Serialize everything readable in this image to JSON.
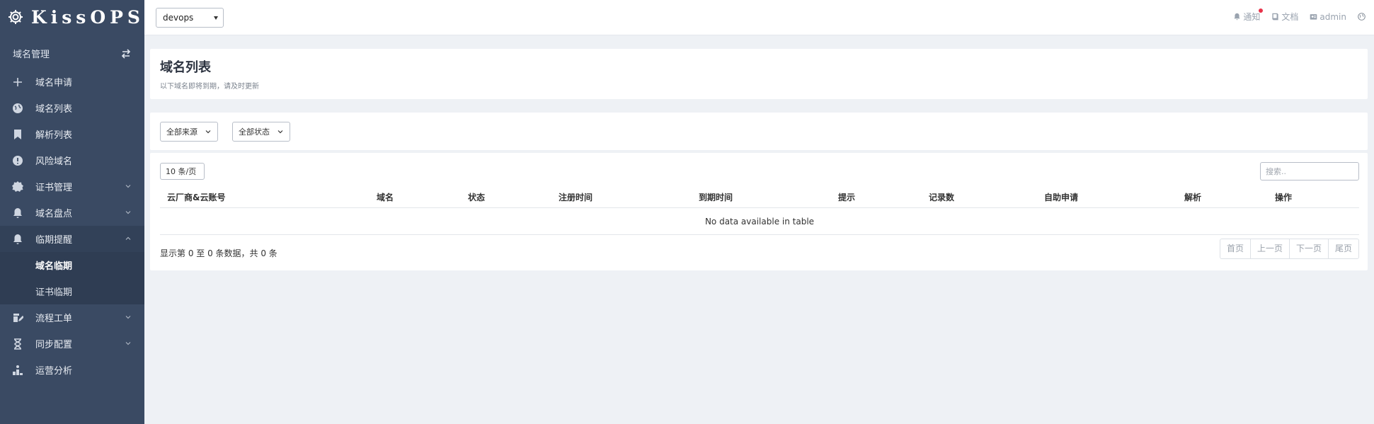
{
  "app": {
    "name": "KissOPS"
  },
  "sidebar": {
    "header": "域名管理",
    "items": [
      {
        "label": "域名申请",
        "icon": "plus-icon"
      },
      {
        "label": "域名列表",
        "icon": "globe-icon"
      },
      {
        "label": "解析列表",
        "icon": "bookmark-icon"
      },
      {
        "label": "风险域名",
        "icon": "alert-icon"
      },
      {
        "label": "证书管理",
        "icon": "certificate-icon"
      },
      {
        "label": "域名盘点",
        "icon": "bell-icon"
      },
      {
        "label": "临期提醒",
        "icon": "bell-icon"
      },
      {
        "label": "流程工单",
        "icon": "edit-icon"
      },
      {
        "label": "同步配置",
        "icon": "hourglass-icon"
      },
      {
        "label": "运营分析",
        "icon": "chart-icon"
      }
    ],
    "submenu": [
      {
        "label": "域名临期",
        "active": true
      },
      {
        "label": "证书临期",
        "active": false
      }
    ]
  },
  "topbar": {
    "env": "devops",
    "notify": "通知",
    "docs": "文档",
    "user": "admin"
  },
  "page": {
    "title": "域名列表",
    "subtitle": "以下域名即将到期，请及时更新"
  },
  "filters": {
    "source": "全部来源",
    "status": "全部状态"
  },
  "table": {
    "page_length": "10 条/页",
    "search_placeholder": "搜索..",
    "columns": [
      "云厂商&云账号",
      "域名",
      "状态",
      "注册时间",
      "到期时间",
      "提示",
      "记录数",
      "自助申请",
      "解析",
      "操作"
    ],
    "empty": "No data available in table",
    "info": "显示第 0 至 0 条数据，共 0 条",
    "pager": {
      "first": "首页",
      "prev": "上一页",
      "next": "下一页",
      "last": "尾页"
    }
  },
  "colors": {
    "sidebar": "#3a4a63",
    "background": "#eef1f5",
    "notify_dot": "#e8334a"
  }
}
